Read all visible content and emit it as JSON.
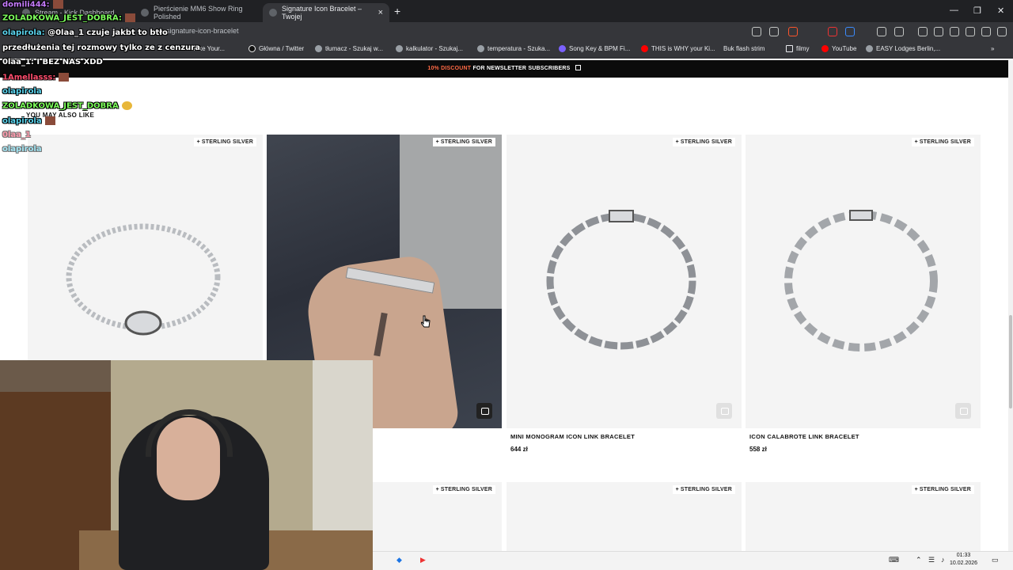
{
  "browser": {
    "tabs": [
      {
        "label": "Stream - Kick Dashboard"
      },
      {
        "label": "Pierścienie MM6 Show Ring Polished"
      },
      {
        "label": "Signature Icon Bracelet – Twojej"
      }
    ],
    "new_tab": "+",
    "url": "signature-icon-bracelet",
    "bookmarks": [
      "Make Your...",
      "Główna / Twitter",
      "tłumacz - Szukaj w...",
      "kalkulator - Szukaj...",
      "temperatura - Szuka...",
      "Song Key & BPM Fi...",
      "THIS is WHY your Ki...",
      "Buk flash strim",
      "filmy",
      "YouTube",
      "EASY Lodges Berlin,..."
    ]
  },
  "promo": {
    "highlight": "10% DISCOUNT",
    "text": "FOR NEWSLETTER SUBSCRIBERS"
  },
  "section_title": "YOU MAY ALSO LIKE",
  "badge_label": "STERLING SILVER",
  "badge_plus": "+",
  "products": [
    {
      "name": "MINI MONOGRAM ICON LINK BRACELET",
      "price": "644 zł"
    },
    {
      "name": "ICON CALABROTE LINK BRACELET",
      "price": "558 zł"
    }
  ],
  "chat": [
    {
      "user": "domili444:",
      "text": "",
      "color": "#c77dff"
    },
    {
      "user": "ZOLADKOWA_JEST_DOBRA:",
      "text": "",
      "color": "#7dff5c"
    },
    {
      "user": "olapirola:",
      "text": "@0laa_1 czuje jakbt to btło",
      "color": "#5bd6f0"
    },
    {
      "user": "",
      "text": "przedłużenia tej rozmowy tylko ze z cenzura",
      "color": "#ffffff"
    },
    {
      "user": "0laa_1:",
      "text": "I BEZ NAS XDD",
      "color": "#ffffff"
    },
    {
      "user": "1Amellasss:",
      "text": "",
      "color": "#ff4d6d"
    },
    {
      "user": "olapirola",
      "text": "",
      "color": "#5bd6f0"
    },
    {
      "user": "ZOLADKOWA_JEST_DOBRA",
      "text": "",
      "color": "#7dff5c"
    },
    {
      "user": "olapirola",
      "text": "",
      "color": "#5bd6f0"
    },
    {
      "user": "0laa_1",
      "text": "",
      "color": "#ff4d6d"
    },
    {
      "user": "olapirola",
      "text": "",
      "color": "#5bd6f0"
    }
  ],
  "clock": {
    "time": "01:33",
    "date": "10.02.2026"
  }
}
